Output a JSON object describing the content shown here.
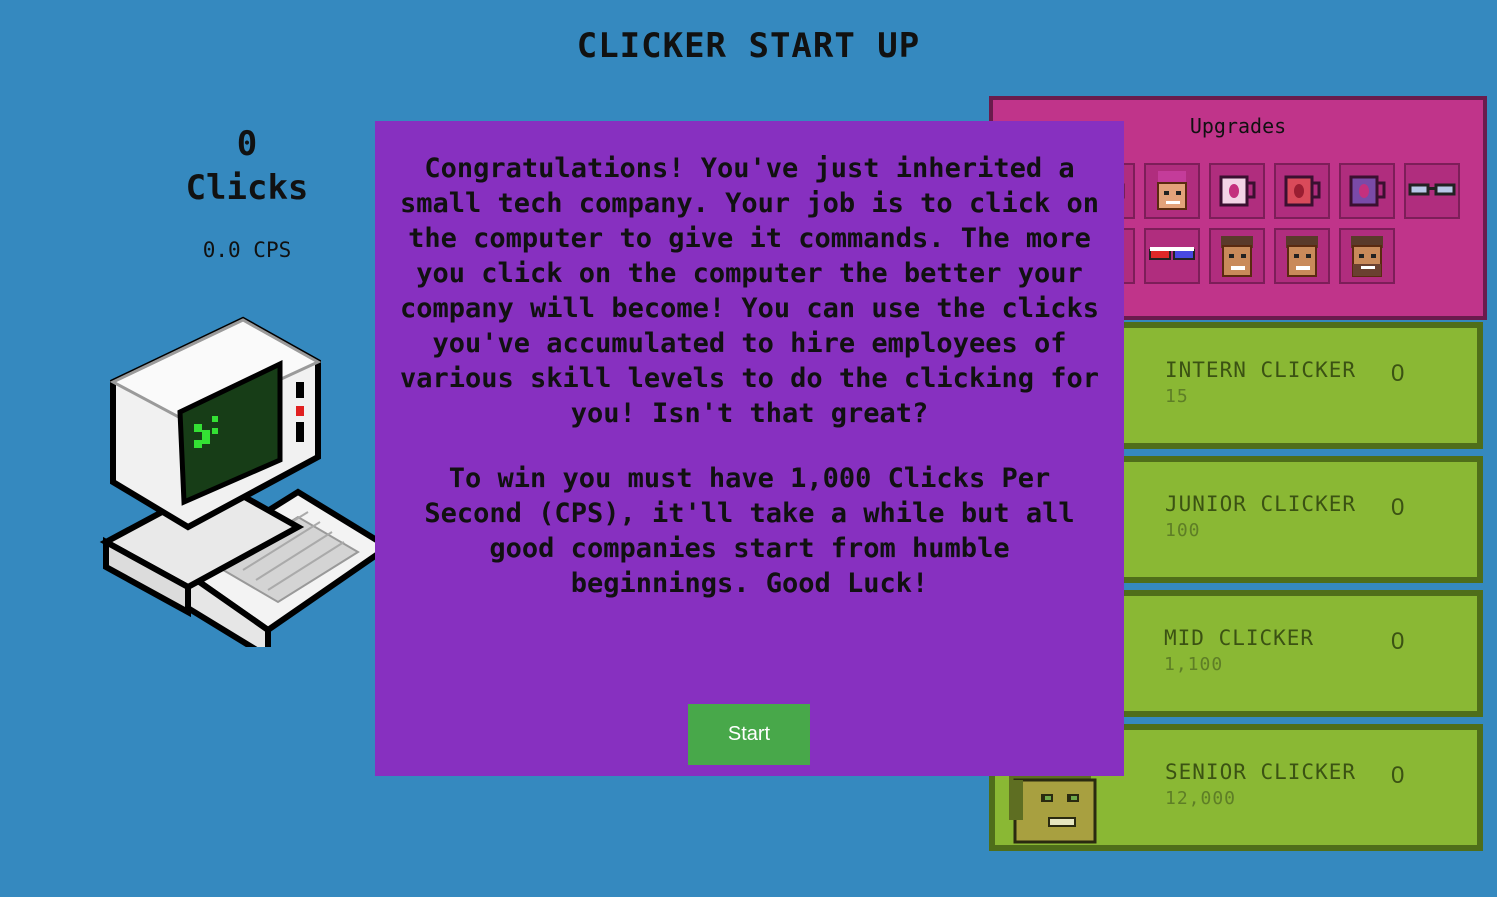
{
  "game": {
    "title": "CLICKER START UP"
  },
  "stats": {
    "clicks_value": "0",
    "clicks_label": "Clicks",
    "cps_text": "0.0 CPS"
  },
  "upgrades": {
    "title": "Upgrades",
    "row1": [
      "mug-icon",
      "face-pink-hair-icon",
      "mug-white-icon",
      "mug-red-icon",
      "mug-purple-icon",
      "glasses-icon"
    ],
    "row2": [
      "mug-icon",
      "3d-glasses-icon",
      "face-brown-icon",
      "face-brown-icon",
      "face-beard-icon"
    ]
  },
  "employees": [
    {
      "name": "INTERN CLICKER",
      "cost": "15",
      "count": "0"
    },
    {
      "name": "JUNIOR CLICKER",
      "cost": "100",
      "count": "0"
    },
    {
      "name": "MID CLICKER",
      "cost": "1,100",
      "count": "0"
    },
    {
      "name": "SENIOR CLICKER",
      "cost": "12,000",
      "count": "0"
    }
  ],
  "intro_modal": {
    "paragraph1": "Congratulations! You've just inherited a small tech company. Your job is to click on the computer to give it commands. The more you click on the computer the better your company will become! You can use the clicks you've accumulated to hire employees of various skill levels to do the clicking for you! Isn't that great?",
    "paragraph2": "To win you must have 1,000 Clicks Per Second (CPS), it'll take a while but all good companies start from humble beginnings. Good Luck!",
    "start_label": "Start"
  },
  "colors": {
    "background": "#3589bf",
    "modal": "#8730c0",
    "upgrades_panel": "#c0348a",
    "employee_card": "#8ab834",
    "start_button": "#48a84a"
  }
}
